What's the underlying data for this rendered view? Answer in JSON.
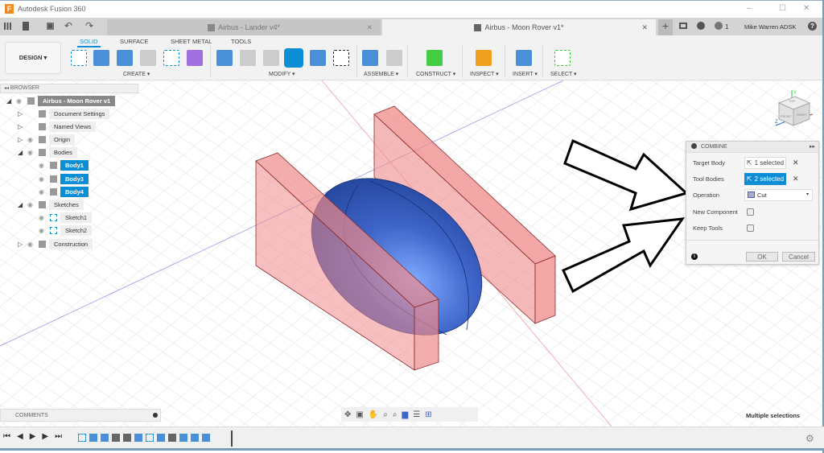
{
  "app_title": "Autodesk Fusion 360",
  "window_controls": {
    "minimize": "–",
    "maximize": "☐",
    "close": "✕"
  },
  "tabs": [
    {
      "label": "Airbus - Lander v4*",
      "active": false
    },
    {
      "label": "Airbus - Moon Rover v1*",
      "active": true
    }
  ],
  "tab_close": "✕",
  "header_right": {
    "plus": "+",
    "jobs_count": "1",
    "user": "Mike Warren ADSK",
    "help": "?"
  },
  "toolbar": {
    "workspace": "DESIGN ▾",
    "tabs": [
      "SOLID",
      "SURFACE",
      "SHEET METAL",
      "TOOLS"
    ],
    "active_tab": "SOLID",
    "groups": [
      "CREATE ▾",
      "MODIFY ▾",
      "ASSEMBLE ▾",
      "CONSTRUCT ▾",
      "INSPECT ▾",
      "INSERT ▾",
      "SELECT ▾"
    ]
  },
  "browser": {
    "title": "BROWSER",
    "items": [
      {
        "label": "Airbus - Moon Rover v1",
        "level": 0,
        "icon": "component-icon"
      },
      {
        "label": "Document Settings",
        "level": 1,
        "icon": "gear-icon"
      },
      {
        "label": "Named Views",
        "level": 1,
        "icon": "folder-icon"
      },
      {
        "label": "Origin",
        "level": 1,
        "icon": "folder-icon"
      },
      {
        "label": "Bodies",
        "level": 1,
        "icon": "folder-icon"
      },
      {
        "label": "Body1",
        "level": 2,
        "icon": "body-icon",
        "selected": true
      },
      {
        "label": "Body3",
        "level": 2,
        "icon": "body-icon",
        "selected": true
      },
      {
        "label": "Body4",
        "level": 2,
        "icon": "body-icon",
        "selected": true
      },
      {
        "label": "Sketches",
        "level": 1,
        "icon": "folder-icon"
      },
      {
        "label": "Sketch1",
        "level": 2,
        "icon": "sketch-icon"
      },
      {
        "label": "Sketch2",
        "level": 2,
        "icon": "sketch-icon"
      },
      {
        "label": "Construction",
        "level": 1,
        "icon": "folder-icon"
      }
    ]
  },
  "combine": {
    "title": "COMBINE",
    "target_body_label": "Target Body",
    "target_body_value": "1 selected",
    "tool_bodies_label": "Tool Bodies",
    "tool_bodies_value": "2 selected",
    "operation_label": "Operation",
    "operation_value": "Cut",
    "new_component_label": "New Component",
    "new_component_checked": false,
    "keep_tools_label": "Keep Tools",
    "keep_tools_checked": false,
    "ok": "OK",
    "cancel": "Cancel"
  },
  "viewcube": {
    "top": "TOP",
    "front": "FRONT",
    "right": "RIGHT"
  },
  "comments": {
    "title": "COMMENTS"
  },
  "status": "Multiple selections",
  "colors": {
    "accent": "#0b8ed6",
    "body_blue": "#3d64c8",
    "tool_red": "#f08a8a"
  }
}
